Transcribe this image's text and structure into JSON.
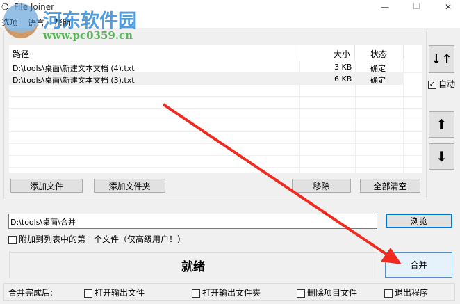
{
  "window": {
    "title": "File Joiner",
    "minimize": "—",
    "maximize": "☐",
    "close": "✕"
  },
  "menu": [
    "选项",
    "语言",
    "帮助"
  ],
  "watermark": {
    "name": "河东软件园",
    "url": "www.pc0359.cn"
  },
  "list": {
    "columns": [
      "路径",
      "大小",
      "状态"
    ],
    "rows": [
      {
        "path": "D:\\tools\\桌面\\新建文本文档 (4).txt",
        "size": "3 KB",
        "status": "确定"
      },
      {
        "path": "D:\\tools\\桌面\\新建文本文档 (3).txt",
        "size": "6 KB",
        "status": "确定"
      }
    ]
  },
  "buttons": {
    "add_file": "添加文件",
    "add_folder": "添加文件夹",
    "remove": "移除",
    "clear_all": "全部清空",
    "browse": "浏览",
    "merge": "合并"
  },
  "side": {
    "sort": "↓↑",
    "auto": "自动",
    "auto_checked": true,
    "up": "⬆",
    "down": "⬇"
  },
  "output_path": "D:\\tools\\桌面\\合并",
  "append_first": {
    "label": "附加到列表中的第一个文件（仅高级用户！）",
    "checked": false
  },
  "status": "就绪",
  "after": {
    "label": "合并完成后:",
    "options": [
      "打开输出文件",
      "打开输出文件夹",
      "删除项目文件",
      "退出程序"
    ]
  }
}
